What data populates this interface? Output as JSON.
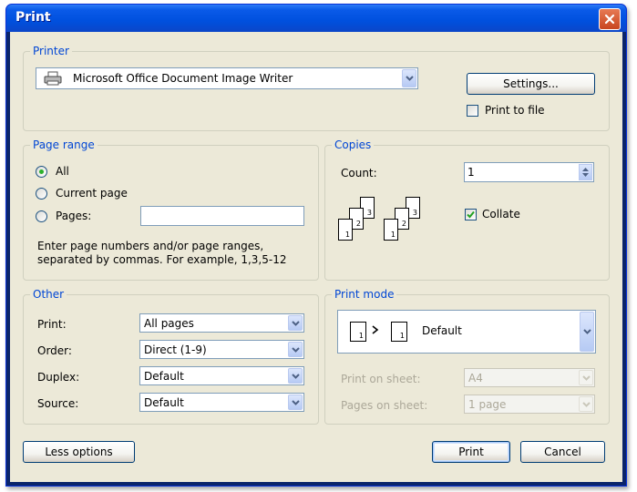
{
  "window": {
    "title": "Print"
  },
  "printer": {
    "group_label": "Printer",
    "selected": "Microsoft Office Document Image Writer",
    "settings_label": "Settings...",
    "print_to_file_label": "Print to file"
  },
  "page_range": {
    "group_label": "Page range",
    "all_label": "All",
    "current_label": "Current page",
    "pages_label": "Pages:",
    "pages_value": "",
    "hint_line1": "Enter page numbers and/or page ranges,",
    "hint_line2": "separated by commas. For example, 1,3,5-12"
  },
  "copies": {
    "group_label": "Copies",
    "count_label": "Count:",
    "count_value": "1",
    "collate_label": "Collate",
    "page_numbers": [
      "3",
      "2",
      "1"
    ]
  },
  "other": {
    "group_label": "Other",
    "print_label": "Print:",
    "print_value": "All pages",
    "order_label": "Order:",
    "order_value": "Direct (1-9)",
    "duplex_label": "Duplex:",
    "duplex_value": "Default",
    "source_label": "Source:",
    "source_value": "Default"
  },
  "print_mode": {
    "group_label": "Print mode",
    "mode_value": "Default",
    "icon_page": "1",
    "print_on_sheet_label": "Print on sheet:",
    "print_on_sheet_value": "A4",
    "pages_on_sheet_label": "Pages on sheet:",
    "pages_on_sheet_value": "1 page"
  },
  "buttons": {
    "less_options": "Less options",
    "print": "Print",
    "cancel": "Cancel"
  }
}
